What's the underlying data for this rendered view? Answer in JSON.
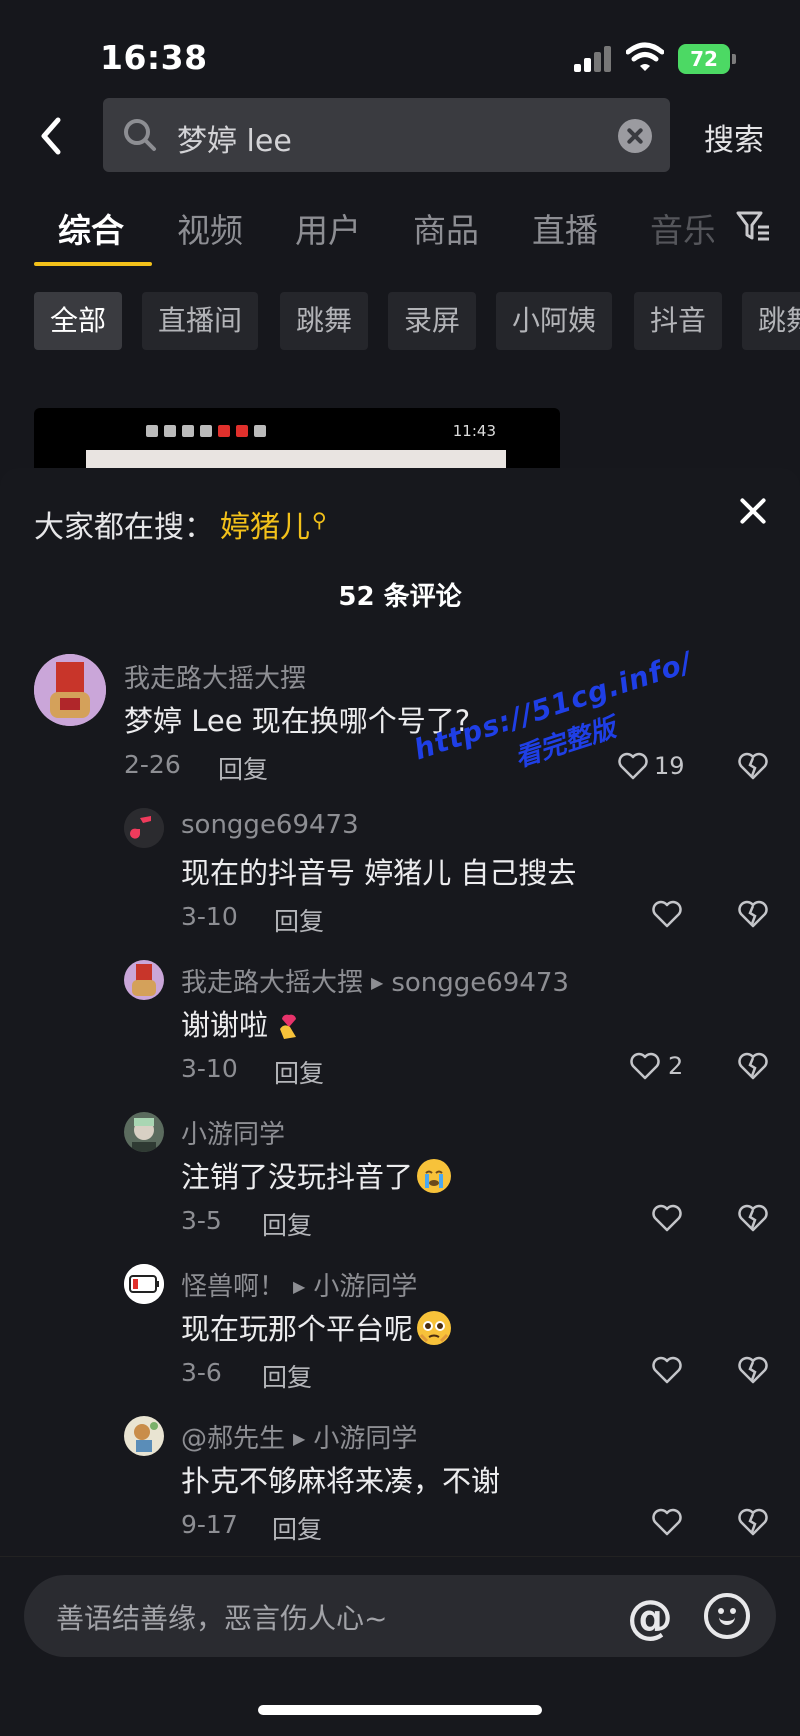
{
  "status_bar": {
    "time": "16:38",
    "battery": "72"
  },
  "search": {
    "query": "梦婷 lee",
    "button_label": "搜索"
  },
  "tabs": [
    {
      "label": "综合",
      "active": true
    },
    {
      "label": "视频"
    },
    {
      "label": "用户"
    },
    {
      "label": "商品"
    },
    {
      "label": "直播"
    },
    {
      "label": "音乐"
    }
  ],
  "chips": [
    {
      "label": "全部",
      "active": true
    },
    {
      "label": "直播间"
    },
    {
      "label": "跳舞"
    },
    {
      "label": "录屏"
    },
    {
      "label": "小阿姨"
    },
    {
      "label": "抖音"
    },
    {
      "label": "跳舞"
    }
  ],
  "video_thumb": {
    "time": "11:43"
  },
  "sheet": {
    "hot_search_prefix": "大家都在搜：",
    "hot_search_keyword": "婷猪儿",
    "comment_count": "52 条评论"
  },
  "comments": [
    {
      "user": "我走路大摇大摆",
      "reply_to": "",
      "text": "梦婷 Lee 现在换哪个号了?",
      "date": "2-26",
      "reply_label": "回复",
      "likes": "19",
      "emoji": ""
    },
    {
      "user": "songge69473",
      "reply_to": "",
      "text": "现在的抖音号 婷猪儿 自己搜去",
      "date": "3-10",
      "reply_label": "回复",
      "likes": "",
      "emoji": ""
    },
    {
      "user": "我走路大摇大摆",
      "reply_to": "songge69473",
      "text": "谢谢啦",
      "date": "3-10",
      "reply_label": "回复",
      "likes": "2",
      "emoji": "heart-hands"
    },
    {
      "user": "小游同学",
      "reply_to": "",
      "text": "注销了没玩抖音了",
      "date": "3-5",
      "reply_label": "回复",
      "likes": "",
      "emoji": "crying-face"
    },
    {
      "user": "怪兽啊！",
      "reply_to": "小游同学",
      "text": "现在玩那个平台呢",
      "date": "3-6",
      "reply_label": "回复",
      "likes": "",
      "emoji": "pleading-face"
    },
    {
      "user": "@郝先生",
      "reply_to": "小游同学",
      "text": "扑克不够麻将来凑，不谢",
      "date": "9-17",
      "reply_label": "回复",
      "likes": "",
      "emoji": ""
    }
  ],
  "watermark": {
    "line1": "https://51cg.info/",
    "line2": "看完整版"
  },
  "input": {
    "placeholder": "善语结善缘，恶言伤人心~"
  },
  "colors": {
    "accent": "#f3c11a",
    "background": "#16171c",
    "watermark": "#1f3fe6"
  }
}
